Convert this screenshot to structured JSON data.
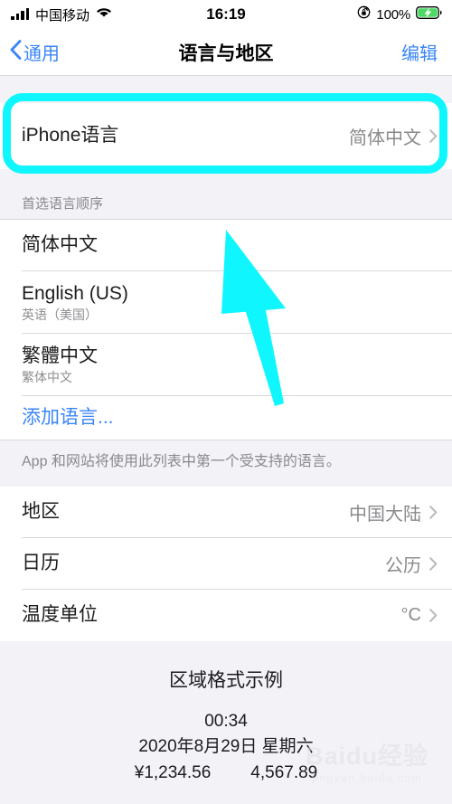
{
  "status_bar": {
    "carrier": "中国移动",
    "signal_icon": "signal-bars-icon",
    "wifi_icon": "wifi-icon",
    "time": "16:19",
    "rotation_lock_icon": "rotation-lock-icon",
    "battery_percent": "100%",
    "battery_icon": "battery-charging-icon"
  },
  "nav": {
    "back_label": "通用",
    "back_icon": "chevron-left-icon",
    "title": "语言与地区",
    "edit_label": "编辑"
  },
  "language_group": {
    "iphone_language_label": "iPhone语言",
    "iphone_language_value": "简体中文"
  },
  "preferred_section": {
    "header": "首选语言顺序",
    "items": [
      {
        "title": "简体中文",
        "subtitle": ""
      },
      {
        "title": "English (US)",
        "subtitle": "英语（美国）"
      },
      {
        "title": "繁體中文",
        "subtitle": "繁体中文"
      }
    ],
    "add_language_label": "添加语言...",
    "footer": "App 和网站将使用此列表中第一个受支持的语言。"
  },
  "region_section": {
    "rows": [
      {
        "label": "地区",
        "value": "中国大陆"
      },
      {
        "label": "日历",
        "value": "公历"
      },
      {
        "label": "温度单位",
        "value": "°C"
      }
    ]
  },
  "format_sample": {
    "title": "区域格式示例",
    "time": "00:34",
    "date": "2020年8月29日 星期六",
    "currency": "¥1,234.56",
    "number": "4,567.89"
  },
  "annotations": {
    "highlight_color": "#0ff6ff",
    "arrow_color": "#0ff6ff"
  },
  "watermark": {
    "main": "Baidu经验",
    "sub": "jingyan.baidu.com"
  }
}
